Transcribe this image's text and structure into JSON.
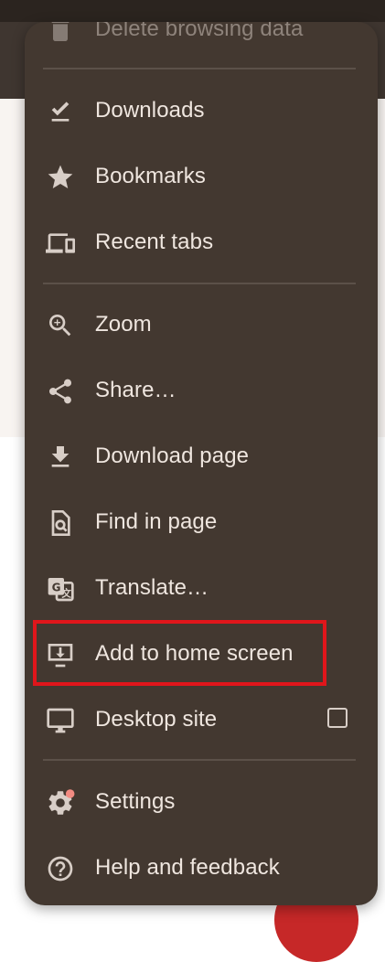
{
  "colors": {
    "menu_bg": "#433830",
    "menu_text": "#efe6df",
    "divider": "#5c5149",
    "highlight": "#e0161b",
    "badge": "#f28b82",
    "fab": "#c62828"
  },
  "menu": {
    "partial_item": {
      "label": "Delete browsing data",
      "icon": "delete-icon"
    },
    "items": [
      {
        "label": "Downloads",
        "icon": "download-done-icon"
      },
      {
        "label": "Bookmarks",
        "icon": "star-icon"
      },
      {
        "label": "Recent tabs",
        "icon": "devices-icon"
      },
      {
        "label": "Zoom",
        "icon": "zoom-in-icon"
      },
      {
        "label": "Share…",
        "icon": "share-icon"
      },
      {
        "label": "Download page",
        "icon": "download-icon"
      },
      {
        "label": "Find in page",
        "icon": "find-in-page-icon"
      },
      {
        "label": "Translate…",
        "icon": "translate-icon"
      },
      {
        "label": "Add to home screen",
        "icon": "add-to-home-screen-icon",
        "highlighted": true
      },
      {
        "label": "Desktop site",
        "icon": "desktop-icon",
        "checkbox": false
      },
      {
        "label": "Settings",
        "icon": "settings-icon",
        "badge": true
      },
      {
        "label": "Help and feedback",
        "icon": "help-icon"
      }
    ]
  }
}
